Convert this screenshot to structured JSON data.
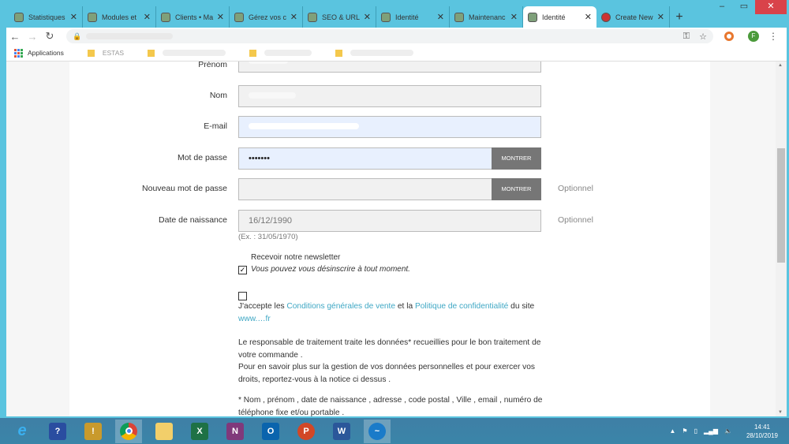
{
  "browser": {
    "tabs": [
      {
        "label": "Statistiques"
      },
      {
        "label": "Modules et"
      },
      {
        "label": "Clients • Ma"
      },
      {
        "label": "Gérez vos c"
      },
      {
        "label": "SEO & URL"
      },
      {
        "label": "Identité"
      },
      {
        "label": "Maintenanc"
      },
      {
        "label": "Identité",
        "active": true
      },
      {
        "label": "Create New"
      }
    ],
    "new_tab": "+",
    "avatar_letter": "F",
    "bookmarks": [
      {
        "label": "Applications"
      },
      {
        "label": "ESTAS"
      }
    ]
  },
  "form": {
    "fields": [
      {
        "label": "Prénom"
      },
      {
        "label": "Nom"
      },
      {
        "label": "E-mail"
      },
      {
        "label": "Mot de passe",
        "value": "•••••••",
        "button": "MONTRER"
      },
      {
        "label": "Nouveau mot de passe",
        "value": "",
        "button": "MONTRER",
        "note": "Optionnel"
      },
      {
        "label": "Date de naissance",
        "value": "16/12/1990",
        "note": "Optionnel"
      }
    ],
    "date_hint": "(Ex. : 31/05/1970)",
    "newsletter_label": "Recevoir notre newsletter",
    "newsletter_note": "Vous pouvez vous désinscrire à tout moment.",
    "newsletter_checked": true,
    "terms_checked": false,
    "terms_prefix": "J'accepte les ",
    "terms_link1": "Conditions générales de vente",
    "terms_mid": " et la ",
    "terms_link2": "Politique de confidentialité",
    "terms_suffix": " du site ",
    "terms_site": "www.…fr",
    "gdpr_p1": "Le responsable de traitement traite les données* recueillies pour le bon traitement de votre commande .",
    "gdpr_p2": "Pour en savoir plus sur la gestion de vos données personnelles et pour exercer vos droits, reportez-vous à la notice ci dessus .",
    "gdpr_p3": "* Nom , prénom , date de naissance , adresse , code postal , Ville , email , numéro de téléphone fixe et/ou portable ."
  },
  "taskbar": {
    "time": "14:41",
    "date": "28/10/2019"
  },
  "colors": {
    "link": "#3ea7c4",
    "frame": "#5ac4df",
    "button": "#767676"
  }
}
